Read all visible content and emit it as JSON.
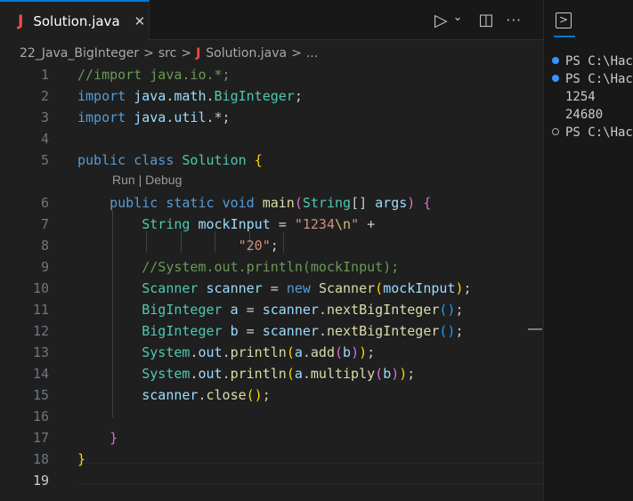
{
  "editor": {
    "tab": {
      "icon": "java-file-icon",
      "icon_glyph": "J",
      "title": "Solution.java",
      "close_glyph": "✕"
    },
    "actions": {
      "run_glyph": "▷",
      "dropdown_glyph": "⌄",
      "split_glyph": "◫",
      "more_glyph": "···"
    },
    "breadcrumb": {
      "folder": "22_Java_BigInteger",
      "subfolder": "src",
      "file": "Solution.java",
      "ellipsis": "...",
      "separator": ">"
    },
    "codelens": "Run | Debug",
    "line_numbers": [
      "1",
      "2",
      "3",
      "4",
      "5",
      "6",
      "7",
      "8",
      "9",
      "10",
      "11",
      "12",
      "13",
      "14",
      "15",
      "16",
      "17",
      "18",
      "19"
    ]
  },
  "terminal": {
    "icon": "terminal-icon",
    "icon_glyph": ">",
    "lines": [
      "PS C:\\Hac",
      "PS C:\\Hac",
      "1254",
      "24680",
      "PS C:\\Hac"
    ]
  },
  "colors": {
    "keyword": "#569cd6",
    "class": "#4ec9b0",
    "string": "#ce9178",
    "comment": "#6a9955",
    "function": "#dcdcaa",
    "variable": "#9cdcfe",
    "accent": "#0078d4",
    "java_icon": "#f14c4c"
  }
}
